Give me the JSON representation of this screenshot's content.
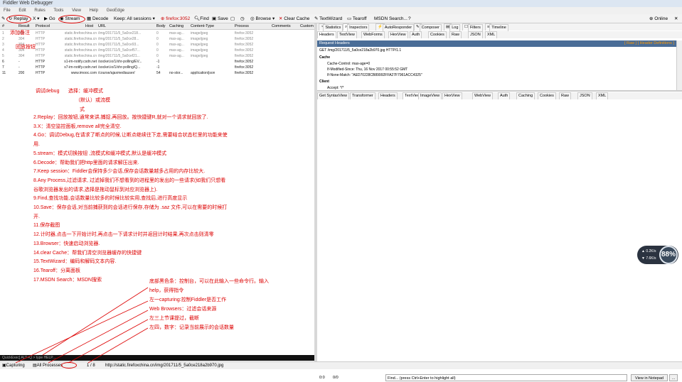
{
  "window": {
    "title": "Fiddler Web Debugger"
  },
  "menu": [
    "File",
    "Edit",
    "Rules",
    "Tools",
    "View",
    "Help",
    "GeoEdge"
  ],
  "toolbar": {
    "replay": "Replay",
    "x": "X",
    "go": "Go",
    "stream": "Stream",
    "decode": "Decode",
    "keep": "Keep: All sessions",
    "process": "firefox:3052",
    "find": "Find",
    "save": "Save",
    "browse": "Browse",
    "clear_cache": "Clear Cache",
    "textwizard": "TextWizard",
    "tearoff": "Tearoff",
    "msdn": "MSDN Search...",
    "online": "Online"
  },
  "session_columns": [
    "#",
    "Result",
    "Protocol",
    "Host",
    "URL",
    "Body",
    "Caching",
    "Content-Type",
    "Process",
    "Comments",
    "Custom"
  ],
  "sessions": [
    {
      "num": "1",
      "result": "304",
      "protocol": "HTTP",
      "host": "static.firefoxchina.cn",
      "url": "/img/201711/5_5a0ce218...",
      "body": "0",
      "caching": "max-ag...",
      "ctype": "image/jpeg",
      "process": "firefox:3052",
      "dark": false
    },
    {
      "num": "2",
      "result": "304",
      "protocol": "HTTP",
      "host": "static.firefoxchina.cn",
      "url": "/img/201711/5_5a0ce28...",
      "body": "0",
      "caching": "max-ag...",
      "ctype": "image/jpeg",
      "process": "firefox:3052",
      "dark": false
    },
    {
      "num": "3",
      "result": "304",
      "protocol": "HTTP",
      "host": "static.firefoxchina.cn",
      "url": "/img/201711/5_5a0ce93...",
      "body": "0",
      "caching": "max-ag...",
      "ctype": "image/jpeg",
      "process": "firefox:3052",
      "dark": false
    },
    {
      "num": "4",
      "result": "304",
      "protocol": "HTTP",
      "host": "static.firefoxchina.cn",
      "url": "/img/201711/5_5a0cef57...",
      "body": "0",
      "caching": "max-ag...",
      "ctype": "image/jpeg",
      "process": "firefox:3052",
      "dark": false
    },
    {
      "num": "5",
      "result": "304",
      "protocol": "HTTP",
      "host": "static.firefoxchina.cn",
      "url": "/img/201711/5_5a0cef21...",
      "body": "0",
      "caching": "max-ag...",
      "ctype": "image/jpeg",
      "process": "firefox:3052",
      "dark": false
    },
    {
      "num": "6",
      "result": "-",
      "protocol": "HTTP",
      "host": "s1-im-notify.csdn.net",
      "url": "/socket.io/1/xhr-polling/EV...",
      "body": "-1",
      "caching": "",
      "ctype": "",
      "process": "firefox:3052",
      "dark": true
    },
    {
      "num": "7",
      "result": "-",
      "protocol": "HTTP",
      "host": "s7-im-notify.csdn.net",
      "url": "/socket.io/1/xhr-polling/Q...",
      "body": "-1",
      "caching": "",
      "ctype": "",
      "process": "firefox:3052",
      "dark": true
    },
    {
      "num": "11",
      "result": "200",
      "protocol": "HTTP",
      "host": "www.imooc.com",
      "url": "/course/ajaxmediauser/",
      "body": "54",
      "caching": "no-stor...",
      "ctype": "application/json",
      "process": "firefox:3052",
      "dark": true
    }
  ],
  "annotations": {
    "add_note": "添加备注",
    "replay_note": "回放按钮",
    "debug_note": "调试debug",
    "mode_note_1": "选择：缓冲模式",
    "mode_note_2": "（默认）或流模",
    "mode_note_3": "式",
    "items": [
      "2.Replay：回放按钮,通常来讲,捕捉,再回放。按快捷键R,就对一个请求就回放了.",
      "3.X：清空监控面板,remove all完全清空.",
      "4.Go：调试Debug,在请求了断点的时候,让断点继续往下走,需要结合状态栏里的功能来使",
      "用.",
      "5.stream：模式切换按钮 ,流模式和缓冲模式,默认是缓冲模式",
      "6.Decode：帮助我们把http里面的请求解压出来.",
      "7.Keep session：Fiddler会保持多少会话,保存会话数量越多占用的内存比较大.",
      "8.Any Process,过滤请求, 过滤掉我们不想看到的进程里的发出的一些请求(如我们只想看",
      "谷歌浏览器发出的请求,选择是拖动鼠标到对应浏览器上).",
      "9.Find,查找功能,会话数量比较多的时候比较实用,查找后,进行高度显示",
      "10.Save：保存会话,对当前捕获到的会话进行保存,存储为 .saz 文件,可以在需要的时候打",
      "开.",
      "11.保存截图",
      "12.计时器,点击一下开始计时,再点击一下请求计时并返回计时结果,再次点击则清零",
      "13.Browser：快速启动浏览器.",
      "14.clear Cache：帮我们清空浏览器缓存的快捷键",
      "15.TextWizard：编码和解码文本内容.",
      "16.Tearoff：分离面板",
      "17.MSDN Search：MSDN搜索"
    ],
    "bottom": [
      "底部黑色条：控制台，可以在此输入一些命令行。输入",
      "help，获得指令",
      "左一capturing:控制Fiddler是否工作",
      "Web Browsers：过滤会话来源",
      "左三上节课提过，截断",
      "左四，数字：记录当前展示的会话数量"
    ]
  },
  "command_line": "QuickExec] ALT+Q > type HELP...",
  "status": {
    "capturing": "Capturing",
    "processes": "All Processes",
    "count": "1 / 8",
    "url": "http://static.firefoxchina.cn/img/201711/5_5a0ce218a2b970.jpg"
  },
  "right_tabs_top": [
    "Statistics",
    "Inspectors",
    "AutoResponder",
    "Composer",
    "Log",
    "Filters",
    "Timeline"
  ],
  "request_tabs": [
    "Headers",
    "TextView",
    "WebForms",
    "HexView",
    "Auth",
    "Cookies",
    "Raw",
    "JSON",
    "XML"
  ],
  "request_headers": {
    "title": "Request Headers",
    "raw_links": "[ Raw ]   [ Header Definitions ]",
    "request_line": "GET /img/201711/5_5a0ce218a2b970.jpg HTTP/1.1",
    "cache_group": "Cache",
    "cache_lines": [
      "Cache-Control: max-age=0",
      "If-Modified-Since: Thu, 16 Nov 2017 00:55:52 GMT",
      "If-None-Match: \"AED70228CB89992FFA27F7961ACC4325\""
    ],
    "client_group": "Client",
    "client_lines": [
      "Accept: */*"
    ]
  },
  "response_tabs": [
    "Get SyntaxView",
    "Transformer",
    "Headers",
    "TextView",
    "ImageView",
    "HexView",
    "WebView",
    "Auth",
    "Caching",
    "Cookies",
    "Raw",
    "JSON",
    "XML"
  ],
  "find_bar": {
    "position": "0:0",
    "count": "0/0",
    "placeholder": "Find... (press Ctrl+Enter to highlight all)",
    "view_notepad": "View in Notepad",
    "more": "..."
  },
  "net_gauge": {
    "up": "0.2K/s",
    "down": "7.6K/s",
    "percent": "88%"
  }
}
